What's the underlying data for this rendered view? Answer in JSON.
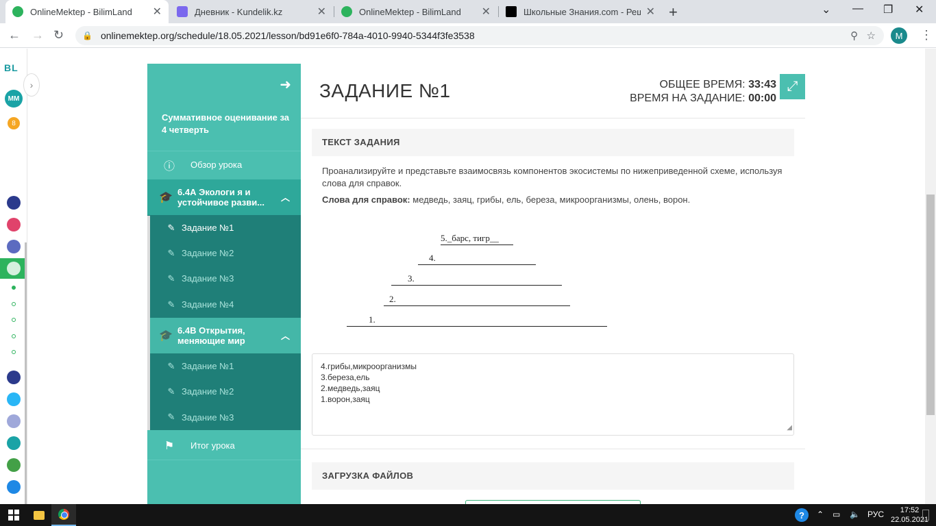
{
  "browser": {
    "tabs": [
      {
        "title": "OnlineMektep - BilimLand",
        "icon": "bilimland-icon",
        "color": "#2db35d"
      },
      {
        "title": "Дневник - Kundelik.kz",
        "icon": "kundelik-icon",
        "color": "#7b68ee"
      },
      {
        "title": "OnlineMektep - BilimLand",
        "icon": "bilimland-icon",
        "color": "#2db35d"
      },
      {
        "title": "Школьные Знания.com - Решае",
        "icon": "znanija-icon",
        "color": "#000000"
      }
    ],
    "url": "onlinemektep.org/schedule/18.05.2021/lesson/bd91e6f0-784a-4010-9940-5344f3fe3538",
    "profile_initial": "M"
  },
  "rail": {
    "logo": "BL",
    "avatar": "MM",
    "notifications": "8"
  },
  "sidebar": {
    "title": "Суммативное оценивание за 4 четверть",
    "overview": "Обзор урока",
    "section1": {
      "label": "6.4А Экологи я и устойчивое разви...",
      "tasks": [
        "Задание №1",
        "Задание №2",
        "Задание №3",
        "Задание №4"
      ]
    },
    "section2": {
      "label": "6.4В Открытия, меняющие мир",
      "tasks": [
        "Задание №1",
        "Задание №2",
        "Задание №3"
      ]
    },
    "summary": "Итог урока"
  },
  "main": {
    "title": "ЗАДАНИЕ №1",
    "total_time_label": "ОБЩЕЕ ВРЕМЯ:",
    "total_time": "33:43",
    "task_time_label": "ВРЕМЯ НА ЗАДАНИЕ:",
    "task_time": "00:00",
    "task_header": "ТЕКСТ ЗАДАНИЯ",
    "task_text": "Проанализируйте и представьте взаимосвязь компонентов экосистемы по нижеприведенной схеме, используя слова для справок.",
    "hint_label": "Слова для справок:",
    "hint_words": " медведь, заяц, грибы, ель, береза, микроорганизмы, олень, ворон.",
    "pyramid": {
      "row5": "5._барс, тигр__",
      "row4": "4.",
      "row3": "3.",
      "row2": "2.",
      "row1": "1."
    },
    "answer_lines": [
      "4.грибы,микроорганизмы",
      "3.береза,ель",
      "2.медведь,заяц",
      "1.ворон,заяц"
    ],
    "upload_header": "ЗАГРУЗКА ФАЙЛОВ"
  },
  "taskbar": {
    "lang": "РУС",
    "time": "17:52",
    "date": "22.05.2021"
  }
}
